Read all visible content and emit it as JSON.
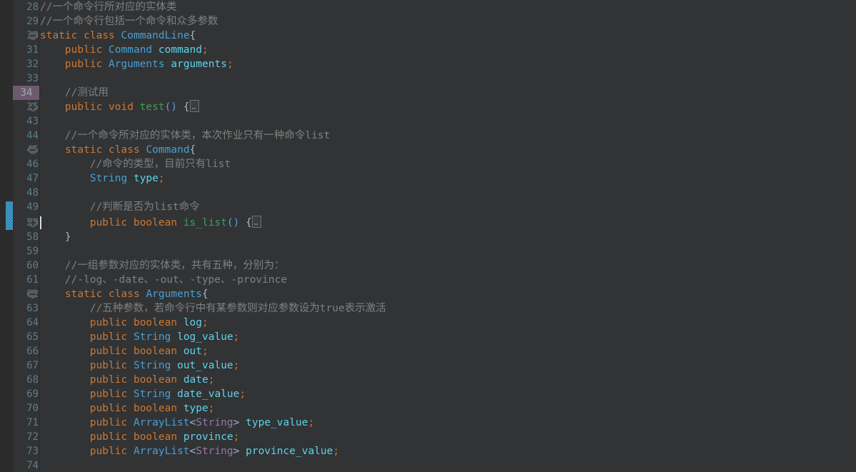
{
  "editor": {
    "name": "java-source-code-editor",
    "theme": "darcula",
    "background": "#313335",
    "gutter_background": "#313335",
    "left_strip_background": "#2b2b2b",
    "line_number_color": "#5e7d8c",
    "current_line_background": "#3a3a3c",
    "highlighted_line_number_background": "#6e5a6e",
    "change_marker_color": "#48a3cc",
    "caret_color": "#dcdcdc",
    "colors": {
      "comment": "#808080",
      "keyword": "#cc7832",
      "class_name": "#4a9fd4",
      "field_name": "#5fd3e8",
      "method_name": "#3f9e5a",
      "generic_type": "#9876aa",
      "plain": "#a9b7c6",
      "paren": "#5b9fd4"
    }
  },
  "gutter": {
    "line_numbers": [
      "28",
      "29",
      "30",
      "31",
      "32",
      "33",
      "34",
      "35",
      "43",
      "44",
      "45",
      "46",
      "47",
      "48",
      "49",
      "50",
      "58",
      "59",
      "60",
      "61",
      "62",
      "63",
      "64",
      "65",
      "66",
      "67",
      "68",
      "69",
      "70",
      "71",
      "72",
      "73",
      "74"
    ],
    "highlighted_line_number": "34",
    "fold_markers": [
      {
        "line": "30",
        "type": "collapse"
      },
      {
        "line": "35",
        "type": "expand"
      },
      {
        "line": "45",
        "type": "collapse"
      },
      {
        "line": "50",
        "type": "expand"
      },
      {
        "line": "62",
        "type": "collapse"
      }
    ],
    "change_marker_lines": [
      "49",
      "50"
    ]
  },
  "code": {
    "lines": [
      {
        "n": "28",
        "text": "    //一个命令行所对应的实体类"
      },
      {
        "n": "29",
        "text": "    //一个命令行包括一个命令和众多参数"
      },
      {
        "n": "30",
        "text": "    static class CommandLine{"
      },
      {
        "n": "31",
        "text": "        public Command command;"
      },
      {
        "n": "32",
        "text": "        public Arguments arguments;"
      },
      {
        "n": "33",
        "text": ""
      },
      {
        "n": "34",
        "text": "        //测试用"
      },
      {
        "n": "35",
        "text": "        public void test() {…"
      },
      {
        "n": "43",
        "text": ""
      },
      {
        "n": "44",
        "text": "        //一个命令所对应的实体类，本次作业只有一种命令list"
      },
      {
        "n": "45",
        "text": "        static class Command{"
      },
      {
        "n": "46",
        "text": "            //命令的类型，目前只有list"
      },
      {
        "n": "47",
        "text": "            String type;"
      },
      {
        "n": "48",
        "text": ""
      },
      {
        "n": "49",
        "text": "            //判断是否为list命令"
      },
      {
        "n": "50",
        "text": "            public boolean is_list() {…"
      },
      {
        "n": "58",
        "text": "        }"
      },
      {
        "n": "59",
        "text": ""
      },
      {
        "n": "60",
        "text": "        //一组参数对应的实体类，共有五种，分别为："
      },
      {
        "n": "61",
        "text": "        //-log、-date、-out、-type、-province"
      },
      {
        "n": "62",
        "text": "        static class Arguments{"
      },
      {
        "n": "63",
        "text": "            //五种参数，若命令行中有某参数则对应参数设为true表示激活"
      },
      {
        "n": "64",
        "text": "            public boolean log;"
      },
      {
        "n": "65",
        "text": "            public String log_value;"
      },
      {
        "n": "66",
        "text": "            public boolean out;"
      },
      {
        "n": "67",
        "text": "            public String out_value;"
      },
      {
        "n": "68",
        "text": "            public boolean date;"
      },
      {
        "n": "69",
        "text": "            public String date_value;"
      },
      {
        "n": "70",
        "text": "            public boolean type;"
      },
      {
        "n": "71",
        "text": "            public ArrayList<String> type_value;"
      },
      {
        "n": "72",
        "text": "            public boolean province;"
      },
      {
        "n": "73",
        "text": "            public ArrayList<String> province_value;"
      },
      {
        "n": "74",
        "text": ""
      }
    ],
    "tokens": {
      "l28_comment": "//一个命令行所对应的实体类",
      "l29_comment": "//一个命令行包括一个命令和众多参数",
      "l30_static": "static",
      "l30_class": "class",
      "l30_name": "CommandLine",
      "l30_brace": "{",
      "l31_public": "public",
      "l31_type": "Command",
      "l31_field": "command",
      "l31_semi": ";",
      "l32_public": "public",
      "l32_type": "Arguments",
      "l32_field": "arguments",
      "l32_semi": ";",
      "l34_comment": "//测试用",
      "l35_public": "public",
      "l35_void": "void",
      "l35_method": "test",
      "l35_parens": "()",
      "l35_brace": "{",
      "l44_comment": "//一个命令所对应的实体类，本次作业只有一种命令list",
      "l45_static": "static",
      "l45_class": "class",
      "l45_name": "Command",
      "l45_brace": "{",
      "l46_comment": "//命令的类型，目前只有list",
      "l47_type": "String",
      "l47_field": "type",
      "l47_semi": ";",
      "l49_comment": "//判断是否为list命令",
      "l50_public": "public",
      "l50_boolean": "boolean",
      "l50_method": "is_list",
      "l50_parens": "()",
      "l50_brace": "{",
      "l58_brace": "}",
      "l60_comment": "//一组参数对应的实体类，共有五种，分别为：",
      "l61_comment": "//-log、-date、-out、-type、-province",
      "l62_static": "static",
      "l62_class": "class",
      "l62_name": "Arguments",
      "l62_brace": "{",
      "l63_comment": "//五种参数，若命令行中有某参数则对应参数设为true表示激活",
      "public": "public",
      "boolean": "boolean",
      "String": "String",
      "ArrayList": "ArrayList",
      "semi": ";",
      "lt": "<",
      "gt": ">",
      "f_log": "log",
      "f_log_value": "log_value",
      "f_out": "out",
      "f_out_value": "out_value",
      "f_date": "date",
      "f_date_value": "date_value",
      "f_type": "type",
      "f_type_value": "type_value",
      "f_province": "province",
      "f_province_value": "province_value"
    }
  }
}
